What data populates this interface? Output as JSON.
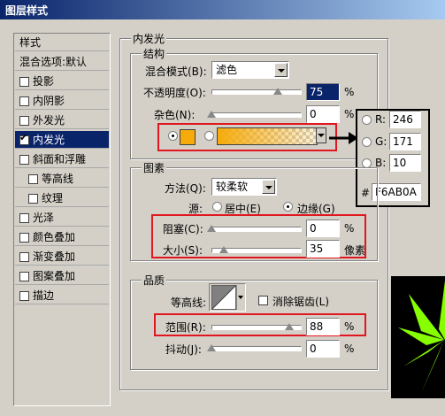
{
  "window": {
    "title": "图层样式"
  },
  "sidebar": {
    "items": [
      {
        "label": "样式",
        "type": "head",
        "checked": false
      },
      {
        "label": "混合选项:默认",
        "type": "head",
        "checked": false
      },
      {
        "label": "投影",
        "type": "item",
        "checked": false
      },
      {
        "label": "内阴影",
        "type": "item",
        "checked": false
      },
      {
        "label": "外发光",
        "type": "item",
        "checked": false
      },
      {
        "label": "内发光",
        "type": "item",
        "checked": true,
        "selected": true
      },
      {
        "label": "斜面和浮雕",
        "type": "item",
        "checked": false
      },
      {
        "label": "等高线",
        "type": "sub",
        "checked": false
      },
      {
        "label": "纹理",
        "type": "sub",
        "checked": false
      },
      {
        "label": "光泽",
        "type": "item",
        "checked": false
      },
      {
        "label": "颜色叠加",
        "type": "item",
        "checked": false
      },
      {
        "label": "渐变叠加",
        "type": "item",
        "checked": false
      },
      {
        "label": "图案叠加",
        "type": "item",
        "checked": false
      },
      {
        "label": "描边",
        "type": "item",
        "checked": false
      }
    ]
  },
  "inner_glow": {
    "title": "内发光",
    "structure": {
      "title": "结构",
      "blend_mode_label": "混合模式(B):",
      "blend_mode_value": "滤色",
      "opacity_label": "不透明度(O):",
      "opacity_value": "75",
      "opacity_fraction": 0.75,
      "noise_label": "杂色(N):",
      "noise_value": "0",
      "noise_fraction": 0,
      "percent": "%",
      "swatch_color": "#F6AB0A",
      "color_radio_selected": true
    },
    "elements": {
      "title": "图素",
      "technique_label": "方法(Q):",
      "technique_value": "较柔软",
      "source_label": "源:",
      "source_center": "居中(E)",
      "source_edge": "边缘(G)",
      "choke_label": "阻塞(C):",
      "choke_value": "0",
      "choke_fraction": 0,
      "size_label": "大小(S):",
      "size_value": "35",
      "size_fraction": 0.14,
      "size_unit": "像素",
      "percent": "%"
    },
    "quality": {
      "title": "品质",
      "contour_label": "等高线:",
      "antialias_label": "消除锯齿(L)",
      "range_label": "范围(R):",
      "range_value": "88",
      "range_fraction": 0.88,
      "jitter_label": "抖动(J):",
      "jitter_value": "0",
      "jitter_fraction": 0,
      "percent": "%"
    }
  },
  "color_picker": {
    "r_label": "R:",
    "r_value": "246",
    "g_label": "G:",
    "g_value": "171",
    "b_label": "B:",
    "b_value": "10",
    "hex_label": "#",
    "hex_value": "F6AB0A"
  },
  "colors": {
    "accent": "#0a246a",
    "highlight_box": "#e0171f",
    "glow": "#F6AB0A",
    "preview_leaf": "#88ff00"
  }
}
